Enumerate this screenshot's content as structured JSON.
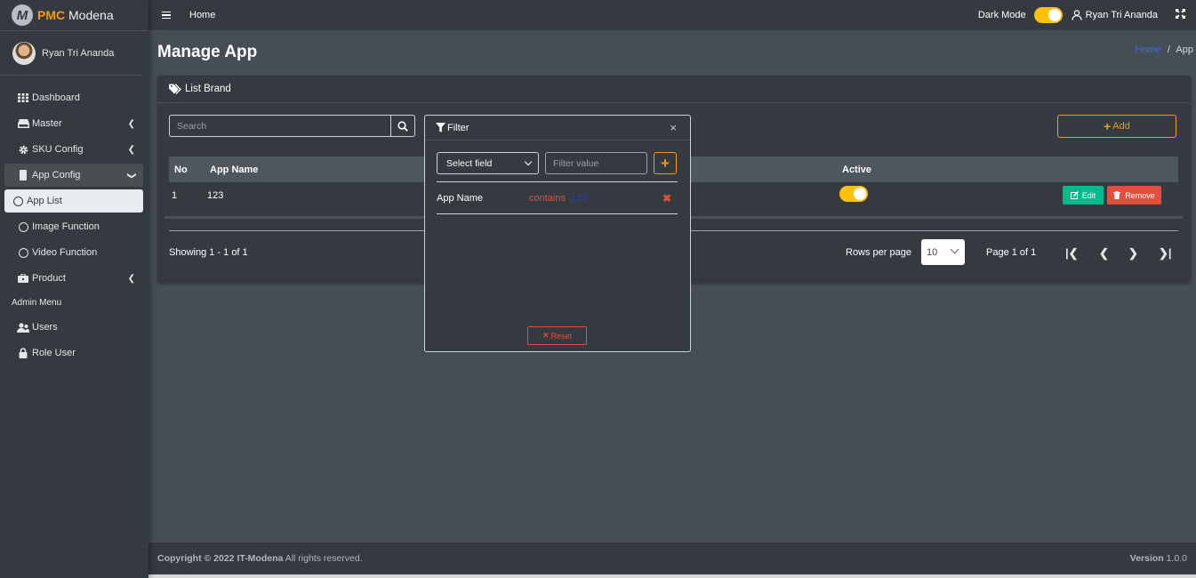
{
  "brand": {
    "bold": "PMC",
    "rest": " Modena",
    "logo_letter": "M"
  },
  "sidebar": {
    "user_name": "Ryan Tri Ananda",
    "items": [
      {
        "label": "Dashboard",
        "icon": "th-icon"
      },
      {
        "label": "Master",
        "icon": "hdd-icon"
      },
      {
        "label": "SKU Config",
        "icon": "gear-icon"
      },
      {
        "label": "App Config",
        "icon": "mobile-icon"
      },
      {
        "label": "App List",
        "icon": "circle-icon"
      },
      {
        "label": "Image Function",
        "icon": "circle-icon"
      },
      {
        "label": "Video Function",
        "icon": "circle-icon"
      },
      {
        "label": "Product",
        "icon": "briefcase-icon"
      }
    ],
    "admin_header": "Admin Menu",
    "admin_items": [
      {
        "label": "Users",
        "icon": "users-icon"
      },
      {
        "label": "Role User",
        "icon": "lock-icon"
      }
    ]
  },
  "topbar": {
    "home": "Home",
    "dark_mode_label": "Dark Mode",
    "dark_mode_on": true,
    "user_name": "Ryan Tri Ananda"
  },
  "page": {
    "title": "Manage App",
    "breadcrumb_home": "Home",
    "breadcrumb_sep": "/",
    "breadcrumb_current": "App"
  },
  "card": {
    "title": "List Brand",
    "search_placeholder": "Search",
    "add_label": "Add",
    "columns": {
      "no": "No",
      "app_name": "App Name",
      "active": "Active"
    },
    "rows": [
      {
        "no": "1",
        "app_name": "123",
        "active": true,
        "edit": "Edit",
        "remove": "Remove"
      }
    ],
    "showing": "Showing 1 - 1 of 1",
    "rows_per_page_label": "Rows per page",
    "rows_per_page": "10",
    "page_info": "Page 1 of 1"
  },
  "filter": {
    "title": "Filter",
    "close": "×",
    "field_select": "Select field",
    "value_placeholder": "Filter value",
    "add": "+",
    "rule": {
      "field": "App Name",
      "operator": "contains",
      "value": "123",
      "remove": "✖"
    },
    "reset": "Reset"
  },
  "footer": {
    "copyright_prefix": "Copyright © 2022 ",
    "company": "IT-Modena",
    "rights": " All rights reserved.",
    "version_label": "Version",
    "version": " 1.0.0"
  },
  "colors": {
    "accent": "#f39c12",
    "toggle": "#ffc107",
    "success": "#00bc8c",
    "danger": "#e74c3c",
    "link": "#3f6ad8"
  }
}
